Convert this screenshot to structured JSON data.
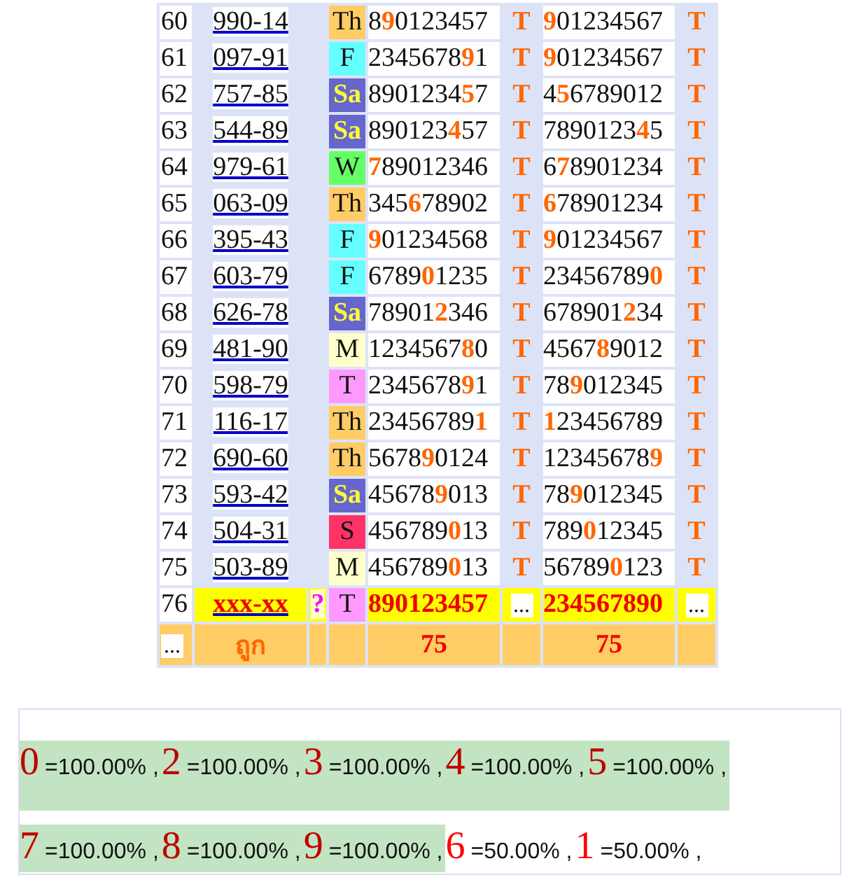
{
  "rows": [
    {
      "kind": "done",
      "num": "60",
      "code": "990-14",
      "day": "Th",
      "color": "#ffcc66",
      "set_1": "8**9**0123457",
      "mark_1": "T",
      "set_2": "**9**01234567",
      "mark_2": "T"
    },
    {
      "kind": "done",
      "num": "61",
      "code": "097-91",
      "day": "F",
      "color": "#66ffff",
      "set_1": "2345678**9**1",
      "mark_1": "T",
      "set_2": "**9**01234567",
      "mark_2": "T"
    },
    {
      "kind": "done",
      "num": "62",
      "code": "757-85",
      "day": "Sa",
      "color": "#6666cc",
      "set_1": "8901234**5**7",
      "mark_1": "T",
      "set_2": "4**5**6789012",
      "mark_2": "T"
    },
    {
      "kind": "done",
      "num": "63",
      "code": "544-89",
      "day": "Sa",
      "color": "#6666cc",
      "set_1": "890123**4**57",
      "mark_1": "T",
      "set_2": "7890123**4**5",
      "mark_2": "T"
    },
    {
      "kind": "done",
      "num": "64",
      "code": "979-61",
      "day": "W",
      "color": "#66ff66",
      "set_1": "**7**89012346",
      "mark_1": "T",
      "set_2": "6**7**8901234",
      "mark_2": "T"
    },
    {
      "kind": "done",
      "num": "65",
      "code": "063-09",
      "day": "Th",
      "color": "#ffcc66",
      "set_1": "345**6**78902",
      "mark_1": "T",
      "set_2": "**6**78901234",
      "mark_2": "T"
    },
    {
      "kind": "done",
      "num": "66",
      "code": "395-43",
      "day": "F",
      "color": "#66ffff",
      "set_1": "**9**01234568",
      "mark_1": "T",
      "set_2": "**9**01234567",
      "mark_2": "T"
    },
    {
      "kind": "done",
      "num": "67",
      "code": "603-79",
      "day": "F",
      "color": "#66ffff",
      "set_1": "6789**0**1235",
      "mark_1": "T",
      "set_2": "23456789**0**",
      "mark_2": "T"
    },
    {
      "kind": "done",
      "num": "68",
      "code": "626-78",
      "day": "Sa",
      "color": "#6666cc",
      "set_1": "78901**2**346",
      "mark_1": "T",
      "set_2": "678901**2**34",
      "mark_2": "T"
    },
    {
      "kind": "done",
      "num": "69",
      "code": "481-90",
      "day": "M",
      "color": "#ffffcc",
      "set_1": "1234567**8**0",
      "mark_1": "T",
      "set_2": "4567**8**9012",
      "mark_2": "T"
    },
    {
      "kind": "done",
      "num": "70",
      "code": "598-79",
      "day": "T",
      "color": "#ff99ff",
      "set_1": "2345678**9**1",
      "mark_1": "T",
      "set_2": "78**9**012345",
      "mark_2": "T"
    },
    {
      "kind": "done",
      "num": "71",
      "code": "116-17",
      "day": "Th",
      "color": "#ffcc66",
      "set_1": "23456789**1**",
      "mark_1": "T",
      "set_2": "**1**23456789",
      "mark_2": "T"
    },
    {
      "kind": "done",
      "num": "72",
      "code": "690-60",
      "day": "Th",
      "color": "#ffcc66",
      "set_1": "5678**9**0124",
      "mark_1": "T",
      "set_2": "12345678**9**",
      "mark_2": "T"
    },
    {
      "kind": "done",
      "num": "73",
      "code": "593-42",
      "day": "Sa",
      "color": "#6666cc",
      "set_1": "45678**9**013",
      "mark_1": "T",
      "set_2": "78**9**012345",
      "mark_2": "T"
    },
    {
      "kind": "done",
      "num": "74",
      "code": "504-31",
      "day": "S",
      "color": "#ff3366",
      "set_1": "456789**0**13",
      "mark_1": "T",
      "set_2": "789**0**12345",
      "mark_2": "T"
    },
    {
      "kind": "done",
      "num": "75",
      "code": "503-89",
      "day": "M",
      "color": "#ffffcc",
      "set_1": "456789**0**13",
      "mark_1": "T",
      "set_2": "56789**0**123",
      "mark_2": "T"
    },
    {
      "kind": "pending",
      "num": "76",
      "code": "xxx-xx",
      "flag": "?",
      "day": "T",
      "color": "#ff99ff",
      "set_1": "890123457",
      "mark_1": "...",
      "set_2": "234567890",
      "mark_2": "..."
    }
  ],
  "footer": {
    "more": "...",
    "label": "ถูก",
    "total_1": "75",
    "total_2": "75"
  },
  "stats": [
    {
      "digit": "0",
      "value": "=100.00%",
      "sep": ",",
      "highlight": true
    },
    {
      "digit": "2",
      "value": "=100.00%",
      "sep": ",",
      "highlight": true
    },
    {
      "digit": "3",
      "value": "=100.00%",
      "sep": ",",
      "highlight": true
    },
    {
      "digit": "4",
      "value": "=100.00%",
      "sep": ",",
      "highlight": true
    },
    {
      "digit": "5",
      "value": "=100.00%",
      "sep": ",",
      "highlight": true
    },
    {
      "digit": "7",
      "value": "=100.00%",
      "sep": ",",
      "highlight": true
    },
    {
      "digit": "8",
      "value": "=100.00%",
      "sep": ",",
      "highlight": true
    },
    {
      "digit": "9",
      "value": "=100.00%",
      "sep": ",",
      "highlight": true
    },
    {
      "digit": "6",
      "value": "=50.00%",
      "sep": ",",
      "highlight": false
    },
    {
      "digit": "1",
      "value": "=50.00%",
      "sep": ",",
      "highlight": false
    }
  ]
}
